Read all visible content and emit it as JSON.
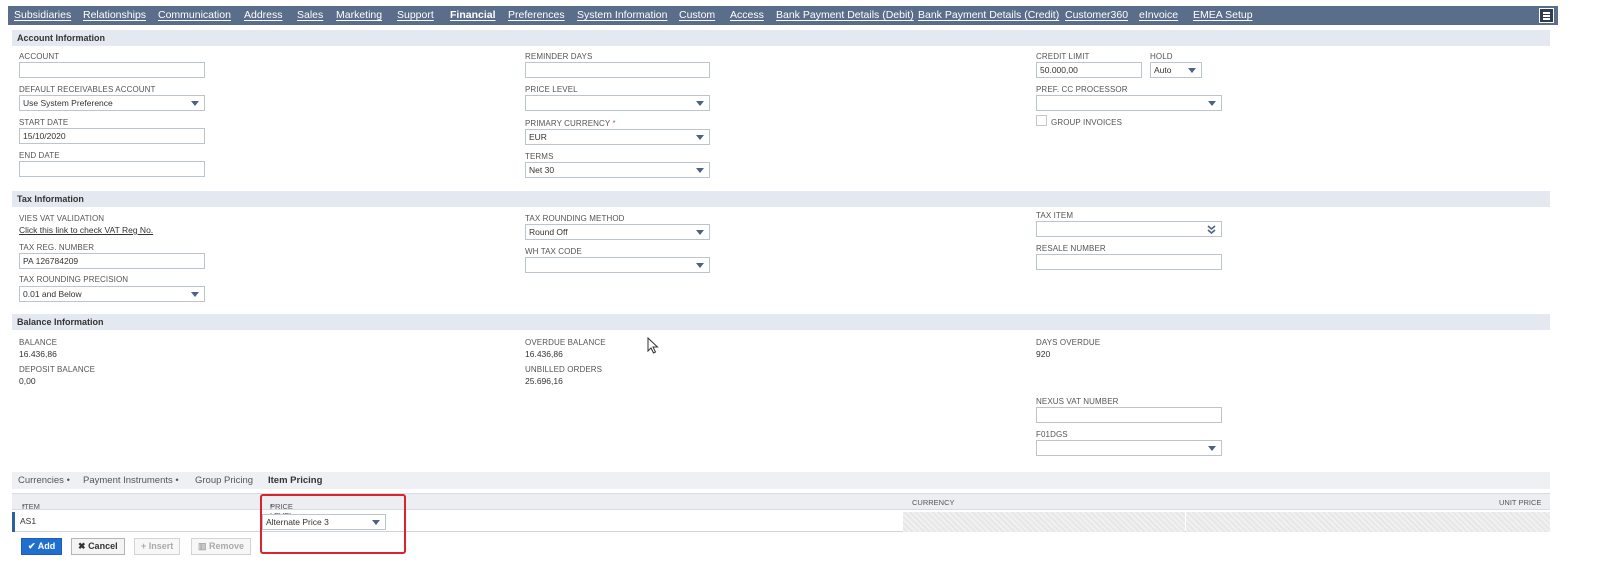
{
  "tabs": [
    {
      "label": "Subsidiaries",
      "active": false
    },
    {
      "label": "Relationships",
      "active": false
    },
    {
      "label": "Communication",
      "active": false
    },
    {
      "label": "Address",
      "active": false
    },
    {
      "label": "Sales",
      "active": false
    },
    {
      "label": "Marketing",
      "active": false
    },
    {
      "label": "Support",
      "active": false
    },
    {
      "label": "Financial",
      "active": true
    },
    {
      "label": "Preferences",
      "active": false
    },
    {
      "label": "System Information",
      "active": false
    },
    {
      "label": "Custom",
      "active": false
    },
    {
      "label": "Access",
      "active": false
    },
    {
      "label": "Bank Payment Details (Debit)",
      "active": false
    },
    {
      "label": "Bank Payment Details (Credit)",
      "active": false
    },
    {
      "label": "Customer360",
      "active": false
    },
    {
      "label": "eInvoice",
      "active": false
    },
    {
      "label": "EMEA Setup",
      "active": false
    }
  ],
  "account_info": {
    "title": "Account Information",
    "account_label": "ACCOUNT",
    "account_value": "",
    "default_receivables_label": "DEFAULT RECEIVABLES ACCOUNT",
    "default_receivables_value": "Use System Preference",
    "start_date_label": "START DATE",
    "start_date_value": "15/10/2020",
    "end_date_label": "END DATE",
    "end_date_value": "",
    "reminder_days_label": "REMINDER DAYS",
    "reminder_days_value": "",
    "price_level_label": "PRICE LEVEL",
    "price_level_value": "",
    "primary_currency_label": "PRIMARY CURRENCY",
    "primary_currency_value": "EUR",
    "terms_label": "TERMS",
    "terms_value": "Net 30",
    "credit_limit_label": "CREDIT LIMIT",
    "credit_limit_value": "50.000,00",
    "hold_label": "HOLD",
    "hold_value": "Auto",
    "pref_cc_label": "PREF. CC PROCESSOR",
    "pref_cc_value": "",
    "group_invoices_label": "GROUP INVOICES"
  },
  "tax_info": {
    "title": "Tax Information",
    "vies_label": "VIES VAT VALIDATION",
    "vies_link": "Click this link to check VAT Reg No.",
    "tax_reg_label": "TAX REG. NUMBER",
    "tax_reg_value": "PA 126784209",
    "tax_rounding_precision_label": "TAX ROUNDING PRECISION",
    "tax_rounding_precision_value": "0.01 and Below",
    "tax_rounding_method_label": "TAX ROUNDING METHOD",
    "tax_rounding_method_value": "Round Off",
    "wh_tax_code_label": "WH TAX CODE",
    "wh_tax_code_value": "",
    "tax_item_label": "TAX ITEM",
    "tax_item_value": "",
    "resale_number_label": "RESALE NUMBER",
    "resale_number_value": ""
  },
  "balance_info": {
    "title": "Balance Information",
    "balance_label": "BALANCE",
    "balance_value": "16.436,86",
    "deposit_balance_label": "DEPOSIT BALANCE",
    "deposit_balance_value": "0,00",
    "overdue_balance_label": "OVERDUE BALANCE",
    "overdue_balance_value": "16.436,86",
    "unbilled_orders_label": "UNBILLED ORDERS",
    "unbilled_orders_value": "25.696,16",
    "days_overdue_label": "DAYS OVERDUE",
    "days_overdue_value": "920",
    "nexus_vat_label": "NEXUS VAT NUMBER",
    "nexus_vat_value": "",
    "f01dgs_label": "F01DGS",
    "f01dgs_value": ""
  },
  "sublist": {
    "tabs": [
      {
        "label": "Currencies •",
        "active": false
      },
      {
        "label": "Payment Instruments •",
        "active": false
      },
      {
        "label": "Group Pricing",
        "active": false
      },
      {
        "label": "Item Pricing",
        "active": true
      }
    ],
    "columns": {
      "item": "ITEM",
      "price_level": "PRICE LEVEL",
      "currency": "CURRENCY",
      "unit_price": "UNIT PRICE"
    },
    "row": {
      "item": "AS1",
      "price_level": "Alternate Price 3",
      "currency": "",
      "unit_price": ""
    },
    "buttons": {
      "add": "Add",
      "cancel": "Cancel",
      "insert": "Insert",
      "remove": "Remove"
    }
  },
  "colors": {
    "tabbar": "#5a6e8c",
    "section_header": "#e4e9f1",
    "primary_button": "#1f6fd1",
    "highlight": "#d9232d"
  }
}
